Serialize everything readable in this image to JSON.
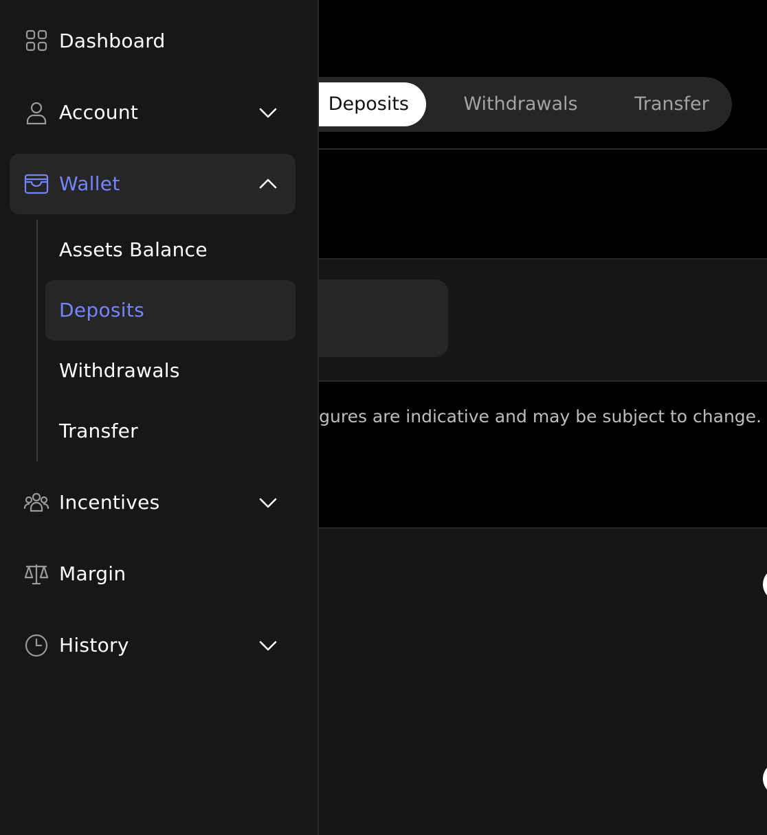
{
  "colors": {
    "accent": "#7584ff",
    "sidebar_bg": "#171717",
    "active_bg": "#262626"
  },
  "sidebar": {
    "items": [
      {
        "label": "Dashboard",
        "icon": "grid-icon"
      },
      {
        "label": "Account",
        "icon": "user-icon",
        "chevron": "chevron-down-icon"
      },
      {
        "label": "Wallet",
        "icon": "wallet-icon",
        "chevron": "chevron-up-icon",
        "expanded": true
      },
      {
        "label": "Incentives",
        "icon": "users-group-icon",
        "chevron": "chevron-down-icon"
      },
      {
        "label": "Margin",
        "icon": "scale-icon"
      },
      {
        "label": "History",
        "icon": "clock-icon",
        "chevron": "chevron-down-icon"
      }
    ],
    "wallet_subitems": [
      {
        "label": "Assets Balance"
      },
      {
        "label": "Deposits",
        "active": true
      },
      {
        "label": "Withdrawals"
      },
      {
        "label": "Transfer"
      }
    ]
  },
  "tabs": [
    {
      "label": "Deposits",
      "active": true
    },
    {
      "label": "Withdrawals"
    },
    {
      "label": "Transfer"
    }
  ],
  "main": {
    "notice": "All figures are indicative and may be subject to change."
  }
}
